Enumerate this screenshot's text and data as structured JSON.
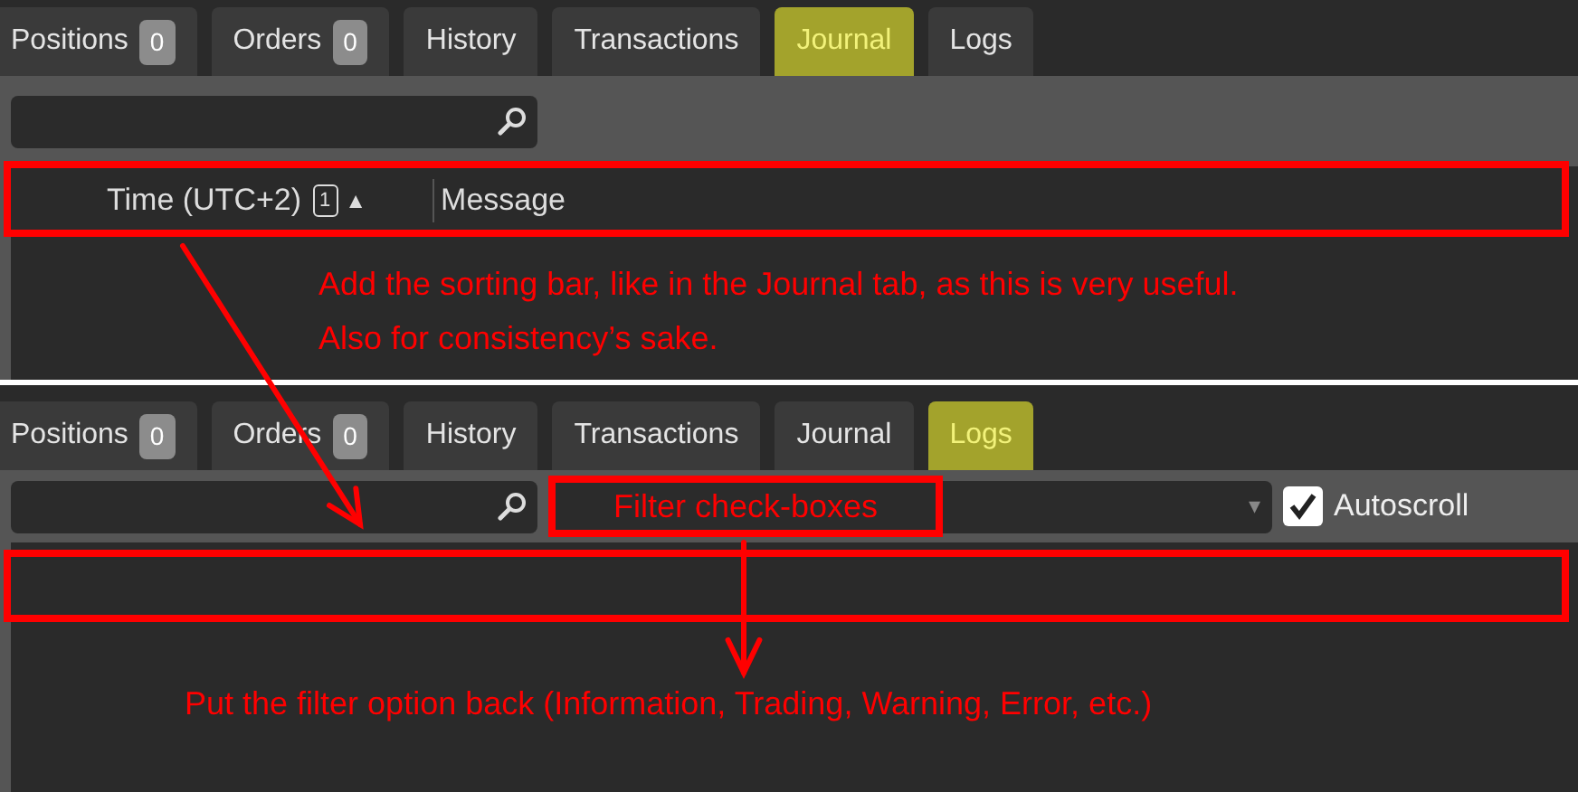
{
  "panels": [
    {
      "tabs": [
        {
          "label": "Positions",
          "count": "0",
          "selected": false
        },
        {
          "label": "Orders",
          "count": "0",
          "selected": false
        },
        {
          "label": "History",
          "selected": false
        },
        {
          "label": "Transactions",
          "selected": false
        },
        {
          "label": "Journal",
          "selected": true
        },
        {
          "label": "Logs",
          "selected": false
        }
      ],
      "toolbar": {
        "search": true
      },
      "columns": [
        {
          "label": "Time (UTC+2)",
          "sort_index": "1",
          "sort_arrow": "▲"
        },
        {
          "label": "Message"
        }
      ],
      "annotation": {
        "lines": [
          "Add the sorting bar, like in the Journal tab, as this is very useful.",
          "Also for consistency’s sake."
        ]
      }
    },
    {
      "tabs": [
        {
          "label": "Positions",
          "count": "0",
          "selected": false
        },
        {
          "label": "Orders",
          "count": "0",
          "selected": false
        },
        {
          "label": "History",
          "selected": false
        },
        {
          "label": "Transactions",
          "selected": false
        },
        {
          "label": "Journal",
          "selected": false
        },
        {
          "label": "Logs",
          "selected": true
        }
      ],
      "toolbar": {
        "search": true,
        "dropdown": {
          "arrow": "▾",
          "label_annotation": "Filter check-boxes"
        },
        "autoscroll": {
          "label": "Autoscroll",
          "checked": true
        }
      },
      "annotation": {
        "lines": [
          "Put the filter option back (Information, Trading, Warning, Error, etc.)"
        ]
      }
    }
  ]
}
